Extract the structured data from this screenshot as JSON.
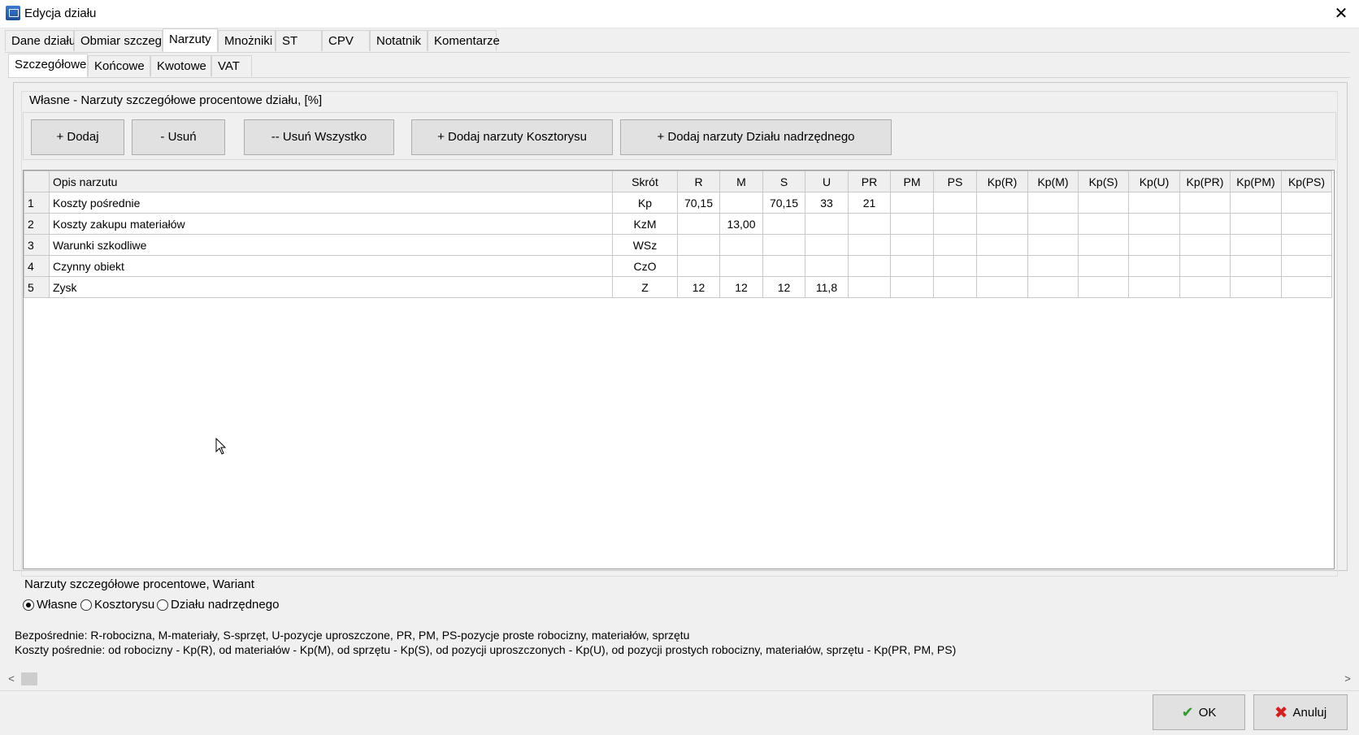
{
  "window": {
    "title": "Edycja działu",
    "close_glyph": "✕"
  },
  "tabs_main": [
    {
      "label": "Dane działu",
      "active": false
    },
    {
      "label": "Obmiar szczeg.",
      "active": false
    },
    {
      "label": "Narzuty",
      "active": true
    },
    {
      "label": "Mnożniki",
      "active": false
    },
    {
      "label": "ST",
      "active": false
    },
    {
      "label": "CPV",
      "active": false
    },
    {
      "label": "Notatnik",
      "active": false
    },
    {
      "label": "Komentarze",
      "active": false
    }
  ],
  "tabs_sub": [
    {
      "label": "Szczegółowe",
      "active": true
    },
    {
      "label": "Końcowe",
      "active": false
    },
    {
      "label": "Kwotowe",
      "active": false
    },
    {
      "label": "VAT",
      "active": false
    }
  ],
  "group": {
    "title": "Własne - Narzuty szczegółowe procentowe działu, [%]"
  },
  "buttons": {
    "add": "+ Dodaj",
    "remove": "- Usuń",
    "remove_all": "-- Usuń Wszystko",
    "add_estimate": "+ Dodaj narzuty Kosztorysu",
    "add_parent": "+ Dodaj narzuty Działu nadrzędnego"
  },
  "table": {
    "columns": [
      "",
      "Opis narzutu",
      "Skrót",
      "R",
      "M",
      "S",
      "U",
      "PR",
      "PM",
      "PS",
      "Kp(R)",
      "Kp(M)",
      "Kp(S)",
      "Kp(U)",
      "Kp(PR)",
      "Kp(PM)",
      "Kp(PS)"
    ],
    "rows": [
      [
        "1",
        "Koszty pośrednie",
        "Kp",
        "70,15",
        "",
        "70,15",
        "33",
        "21",
        "",
        "",
        "",
        "",
        "",
        "",
        "",
        "",
        ""
      ],
      [
        "2",
        "Koszty zakupu materiałów",
        "KzM",
        "",
        "13,00",
        "",
        "",
        "",
        "",
        "",
        "",
        "",
        "",
        "",
        "",
        "",
        ""
      ],
      [
        "3",
        "Warunki szkodliwe",
        "WSz",
        "",
        "",
        "",
        "",
        "",
        "",
        "",
        "",
        "",
        "",
        "",
        "",
        "",
        ""
      ],
      [
        "4",
        "Czynny obiekt",
        "CzO",
        "",
        "",
        "",
        "",
        "",
        "",
        "",
        "",
        "",
        "",
        "",
        "",
        "",
        ""
      ],
      [
        "5",
        "Zysk",
        "Z",
        "12",
        "12",
        "12",
        "11,8",
        "",
        "",
        "",
        "",
        "",
        "",
        "",
        "",
        "",
        ""
      ]
    ]
  },
  "wariant": {
    "title": "Narzuty szczegółowe procentowe, Wariant",
    "options": [
      {
        "label": "Własne",
        "selected": true
      },
      {
        "label": "Kosztorysu",
        "selected": false
      },
      {
        "label": "Działu nadrzędnego",
        "selected": false
      }
    ]
  },
  "legend": {
    "line1": "Bezpośrednie: R-robocizna, M-materiały, S-sprzęt, U-pozycje uproszczone, PR, PM, PS-pozycje proste robocizny, materiałów, sprzętu",
    "line2": "Koszty pośrednie: od robocizny - Kp(R), od materiałów - Kp(M), od sprzętu - Kp(S), od pozycji uproszczonych - Kp(U), od pozycji prostych robocizny, materiałów, sprzętu - Kp(PR, PM, PS)"
  },
  "scrollbar": {
    "left_arrow": "<",
    "right_arrow": ">"
  },
  "dialog": {
    "ok_label": "OK",
    "ok_icon": "✔",
    "cancel_label": "Anuluj",
    "cancel_icon": "✖"
  }
}
